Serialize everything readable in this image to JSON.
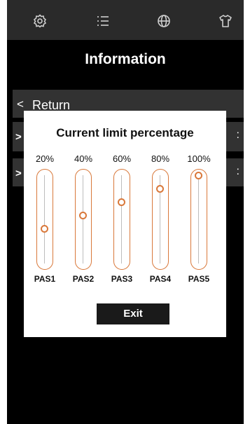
{
  "topbar": {
    "icons": [
      "gear-icon",
      "list-icon",
      "globe-icon",
      "shirt-icon"
    ],
    "icon_color": "#cfcfcf"
  },
  "page": {
    "title": "Information"
  },
  "menu": {
    "return_chevron": "<",
    "return_label": "Return",
    "row_chevron": ">",
    "row_dots": ":"
  },
  "dialog": {
    "title": "Current limit percentage",
    "accent_color": "#d9783a",
    "sliders": [
      {
        "percent_label": "20%",
        "name": "PAS1",
        "level": 0.2
      },
      {
        "percent_label": "40%",
        "name": "PAS2",
        "level": 0.4
      },
      {
        "percent_label": "60%",
        "name": "PAS3",
        "level": 0.6
      },
      {
        "percent_label": "80%",
        "name": "PAS4",
        "level": 0.8
      },
      {
        "percent_label": "100%",
        "name": "PAS5",
        "level": 1.0
      }
    ],
    "exit_label": "Exit"
  }
}
